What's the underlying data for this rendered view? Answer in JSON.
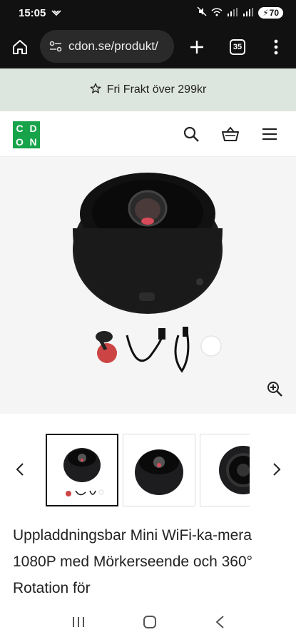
{
  "status_bar": {
    "time": "15:05",
    "battery": "70"
  },
  "browser": {
    "url": "cdon.se/produkt/",
    "tab_count": "35"
  },
  "promo": {
    "text": "Fri Frakt över 299kr"
  },
  "site": {
    "logo_letters": [
      "C",
      "D",
      "O",
      "N"
    ],
    "brand_color": "#17a34a"
  },
  "product": {
    "title": "Uppladdningsbar Mini WiFi-ka-mera 1080P med Mörkerseende och 360° Rotation för",
    "image_count_visible": 3,
    "selected_thumbnail": 1
  },
  "icons": {
    "header": [
      "search-icon",
      "basket-icon",
      "menu-icon"
    ],
    "browser": [
      "home-icon",
      "site-settings-icon",
      "new-tab-icon",
      "tabs-icon",
      "more-icon"
    ],
    "status": [
      "mute-icon",
      "wifi-icon",
      "signal-icon",
      "battery-icon"
    ],
    "system_nav": [
      "recents-icon",
      "home-button-icon",
      "back-icon"
    ]
  }
}
